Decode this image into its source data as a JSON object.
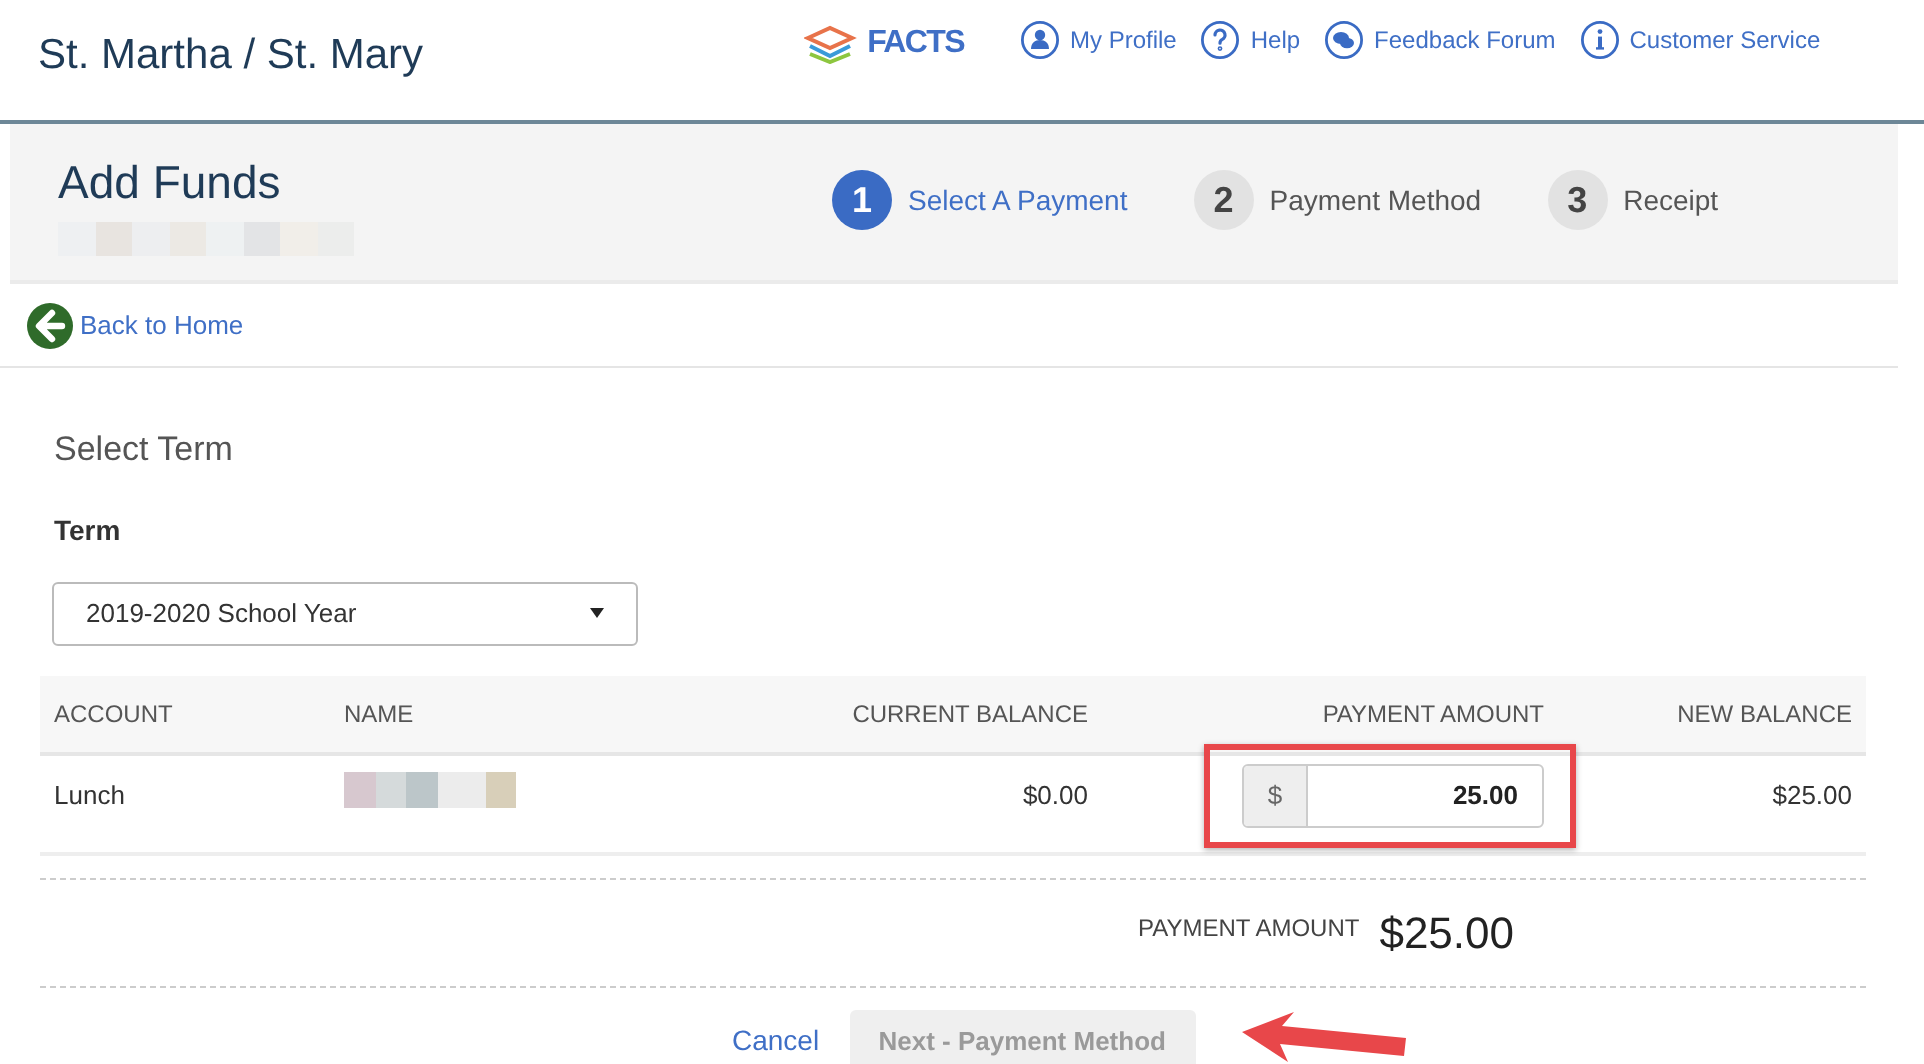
{
  "header": {
    "school": "St. Martha / St. Mary",
    "logo": "FACTS",
    "links": [
      {
        "kind": "profile",
        "label": "My Profile"
      },
      {
        "kind": "help",
        "label": "Help"
      },
      {
        "kind": "forum",
        "label": "Feedback Forum"
      },
      {
        "kind": "info",
        "label": "Customer Service"
      }
    ]
  },
  "page": {
    "title": "Add Funds"
  },
  "steps": [
    {
      "number": "1",
      "label": "Select A Payment",
      "selected": true
    },
    {
      "number": "2",
      "label": "Payment Method",
      "selected": false
    },
    {
      "number": "3",
      "label": "Receipt",
      "selected": false
    }
  ],
  "back_link": "Back to Home",
  "section_title": "Select Term",
  "term": {
    "label": "Term",
    "value": "2019-2020 School Year"
  },
  "table": {
    "columns": [
      "ACCOUNT",
      "NAME",
      "CURRENT BALANCE",
      "PAYMENT AMOUNT",
      "NEW BALANCE"
    ],
    "rows": [
      {
        "account": "Lunch",
        "current_balance": "$0.00",
        "currency": "$",
        "payment_amount": "25.00",
        "new_balance": "$25.00"
      }
    ]
  },
  "total": {
    "label": "PAYMENT AMOUNT",
    "value": "$25.00"
  },
  "actions": {
    "cancel": "Cancel",
    "next": {
      "label": "Next - Payment Method",
      "disabled": true
    }
  }
}
